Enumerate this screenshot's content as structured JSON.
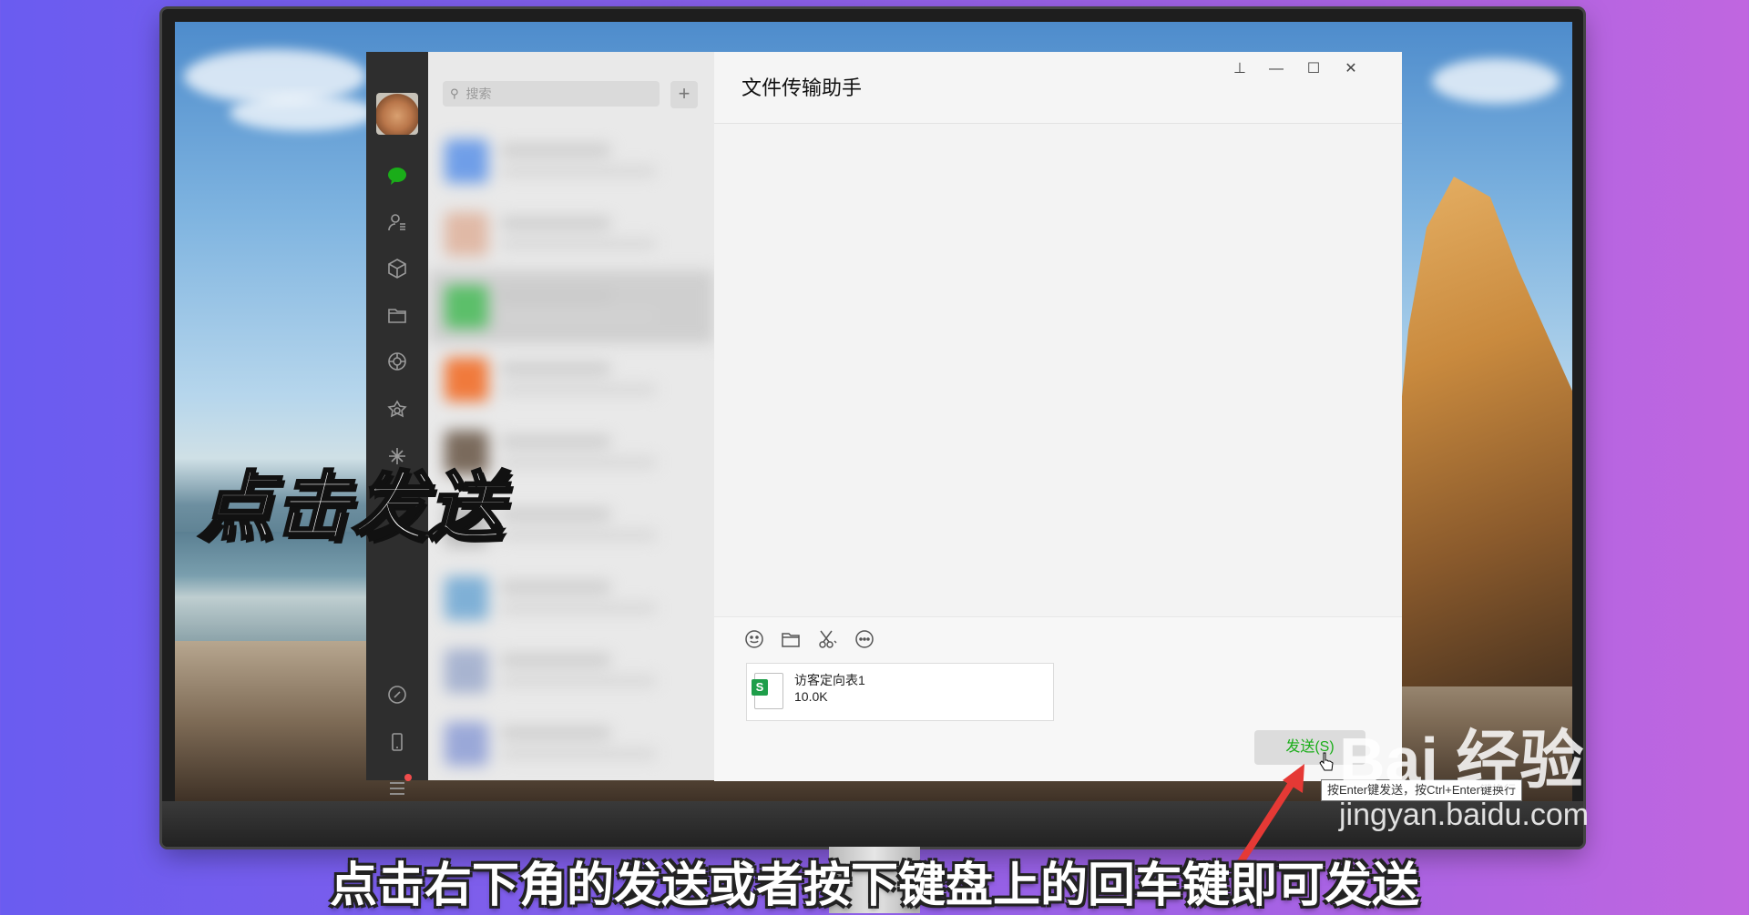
{
  "app": {
    "search_placeholder": "搜索",
    "add_button": "+",
    "chat_title": "文件传输助手",
    "window_controls": {
      "pin": "⊥",
      "minimize": "—",
      "maximize": "☐",
      "close": "✕"
    }
  },
  "toolbar_icons": [
    "emoji-icon",
    "folder-icon",
    "scissors-icon",
    "chat-bubble-icon"
  ],
  "attachment": {
    "name": "访客定向表1",
    "size": "10.0K"
  },
  "send_button": "发送(S)",
  "tooltip": "按Enter键发送，按Ctrl+Enter键换行",
  "overlay_title": "点击发送",
  "caption": "点击右下角的发送或者按下键盘上的回车键即可发送",
  "watermark": {
    "logo": "Bai 经验",
    "url": "jingyan.baidu.com"
  },
  "colors": {
    "accent_green": "#1aad19",
    "arrow_red": "#e53935"
  }
}
